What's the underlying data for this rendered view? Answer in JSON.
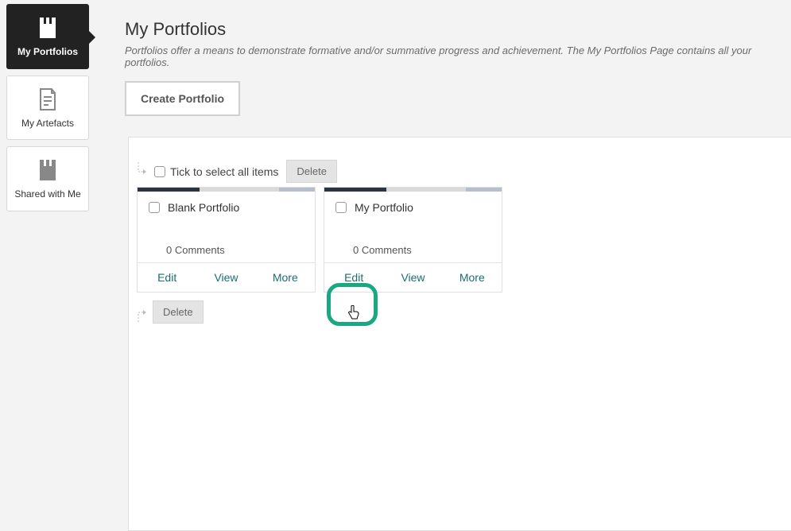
{
  "sidebar": {
    "items": [
      {
        "label": "My Portfolios"
      },
      {
        "label": "My Artefacts"
      },
      {
        "label": "Shared with Me"
      }
    ]
  },
  "header": {
    "title": "My Portfolios",
    "subtitle": "Portfolios offer a means to demonstrate formative and/or summative progress and achievement. The My Portfolios Page contains all your portfolios."
  },
  "create_label": "Create Portfolio",
  "tick_all_label": "Tick to select all items",
  "delete_top_label": "Delete",
  "delete_bottom_label": "Delete",
  "cards": [
    {
      "title": "Blank Portfolio",
      "comments": "0 Comments",
      "edit": "Edit",
      "view": "View",
      "more": "More"
    },
    {
      "title": "My Portfolio",
      "comments": "0 Comments",
      "edit": "Edit",
      "view": "View",
      "more": "More"
    }
  ],
  "colors": {
    "accent": "#1c6e6e",
    "highlight": "#19a882"
  }
}
